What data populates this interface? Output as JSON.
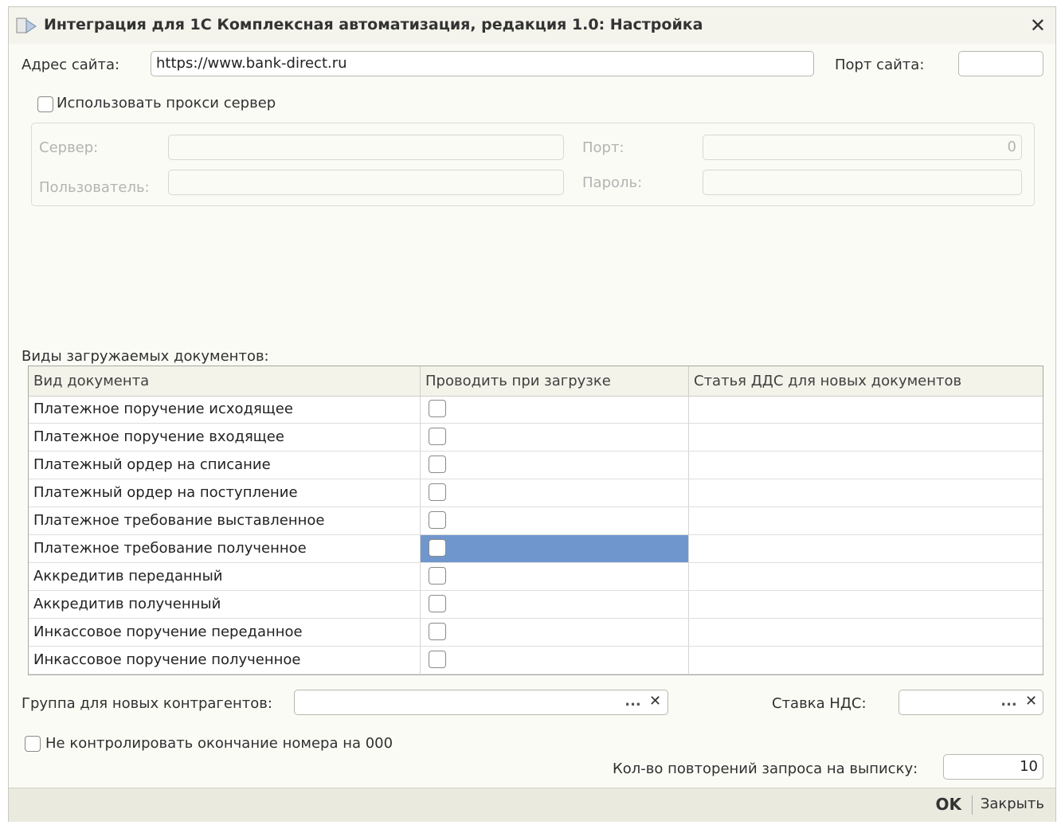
{
  "window": {
    "title": "Интеграция для 1С Комплексная автоматизация, редакция 1.0: Настройка",
    "close_glyph": "✕"
  },
  "site": {
    "address_label": "Адрес сайта:",
    "address_value": "https://www.bank-direct.ru",
    "port_label": "Порт сайта:",
    "port_value": ""
  },
  "proxy": {
    "use_proxy_label": "Использовать прокси сервер",
    "use_proxy_checked": false,
    "server_label": "Сервер:",
    "server_value": "",
    "port_label": "Порт:",
    "port_value": "0",
    "user_label": "Пользователь:",
    "user_value": "",
    "password_label": "Пароль:",
    "password_value": ""
  },
  "documents": {
    "section_label": "Виды загружаемых документов:",
    "columns": [
      "Вид документа",
      "Проводить при загрузке",
      "Статья ДДС для новых документов"
    ],
    "rows": [
      {
        "name": "Платежное поручение исходящее",
        "post": false,
        "dds": "",
        "selected": false
      },
      {
        "name": "Платежное поручение входящее",
        "post": false,
        "dds": "",
        "selected": false
      },
      {
        "name": "Платежный ордер на списание",
        "post": false,
        "dds": "",
        "selected": false
      },
      {
        "name": "Платежный ордер на поступление",
        "post": false,
        "dds": "",
        "selected": false
      },
      {
        "name": "Платежное требование выставленное",
        "post": false,
        "dds": "",
        "selected": false
      },
      {
        "name": "Платежное требование полученное",
        "post": false,
        "dds": "",
        "selected": true
      },
      {
        "name": "Аккредитив переданный",
        "post": false,
        "dds": "",
        "selected": false
      },
      {
        "name": "Аккредитив полученный",
        "post": false,
        "dds": "",
        "selected": false
      },
      {
        "name": "Инкассовое поручение переданное",
        "post": false,
        "dds": "",
        "selected": false
      },
      {
        "name": "Инкассовое поручение полученное",
        "post": false,
        "dds": "",
        "selected": false
      }
    ]
  },
  "bottom": {
    "group_label": "Группа для новых контрагентов:",
    "group_value": "",
    "vat_label": "Ставка НДС:",
    "vat_value": "",
    "select_glyph": "...",
    "clear_glyph": "✕",
    "no_control_label": "Не контролировать окончание номера на 000",
    "no_control_checked": false,
    "retries_label": "Кол-во повторений запроса на выписку:",
    "retries_value": "10"
  },
  "footer": {
    "ok_label": "OK",
    "close_label": "Закрыть"
  },
  "colors": {
    "selection": "#6f97cd",
    "window_bg": "#fbfbf6",
    "footer_bg": "#eaeadf"
  }
}
